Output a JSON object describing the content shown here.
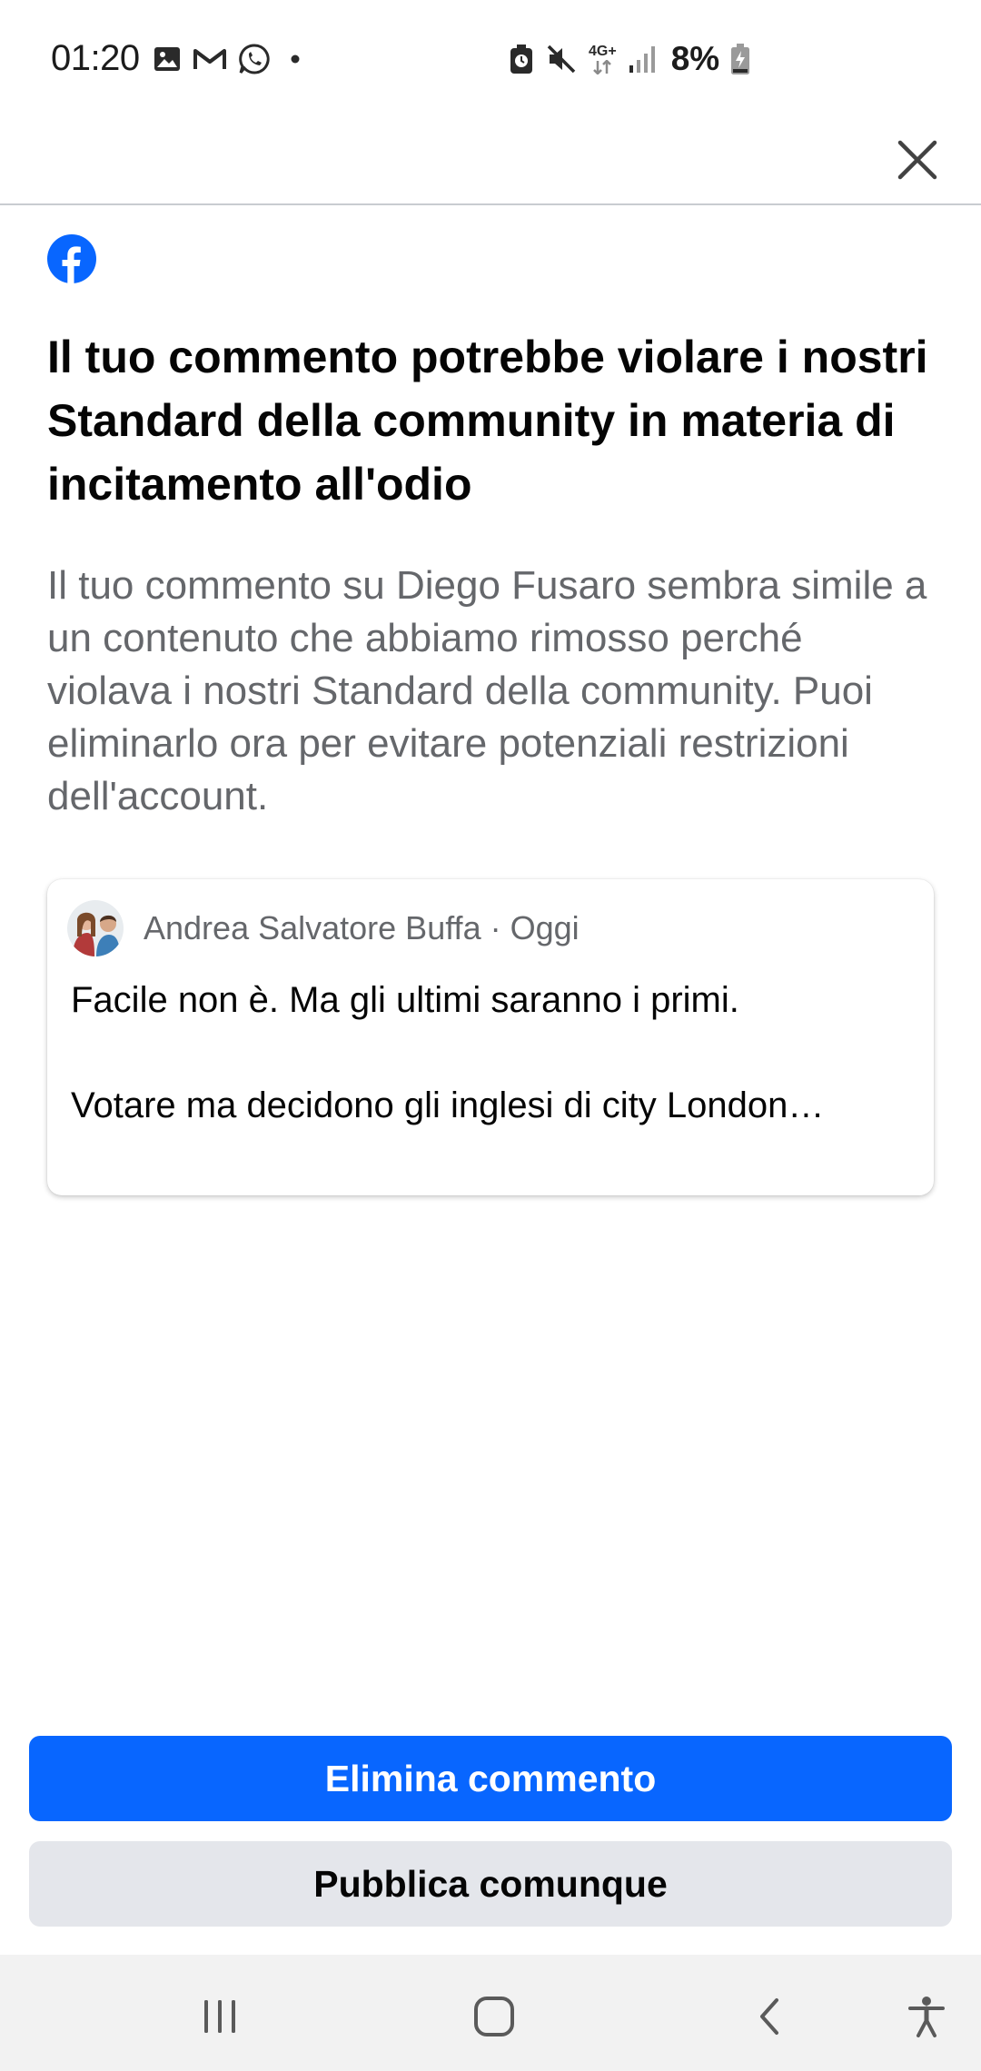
{
  "status_bar": {
    "time": "01:20",
    "notification_icons": [
      "gallery-icon",
      "gmail-icon",
      "whatsapp-icon",
      "dot-icon"
    ],
    "system_icons": [
      "alarm-icon",
      "mute-icon",
      "network-4g-icon",
      "signal-icon"
    ],
    "network_label": "4G+",
    "battery_text": "8%"
  },
  "top_bar": {
    "close_icon": "close-icon"
  },
  "dialog": {
    "logo_icon": "facebook-logo-icon",
    "brand_color": "#0866ff",
    "title": "Il tuo commento potrebbe violare i nostri Standard della community in materia di incitamento all'odio",
    "description": "Il tuo commento su Diego Fusaro sembra simile a un contenuto che abbiamo rimosso perché violava i nostri Standard della community. Puoi eliminarlo ora per evitare potenziali restrizioni dell'account."
  },
  "comment": {
    "author": "Andrea Salvatore Buffa",
    "separator": "·",
    "time": "Oggi",
    "line1": "Facile non è. Ma gli ultimi saranno i primi.",
    "line2": "Votare ma decidono gli inglesi di city London…"
  },
  "actions": {
    "delete_label": "Elimina commento",
    "publish_label": "Pubblica comunque"
  },
  "nav_bar": {
    "items": [
      "recent-apps-icon",
      "home-icon",
      "back-icon",
      "accessibility-icon"
    ]
  }
}
